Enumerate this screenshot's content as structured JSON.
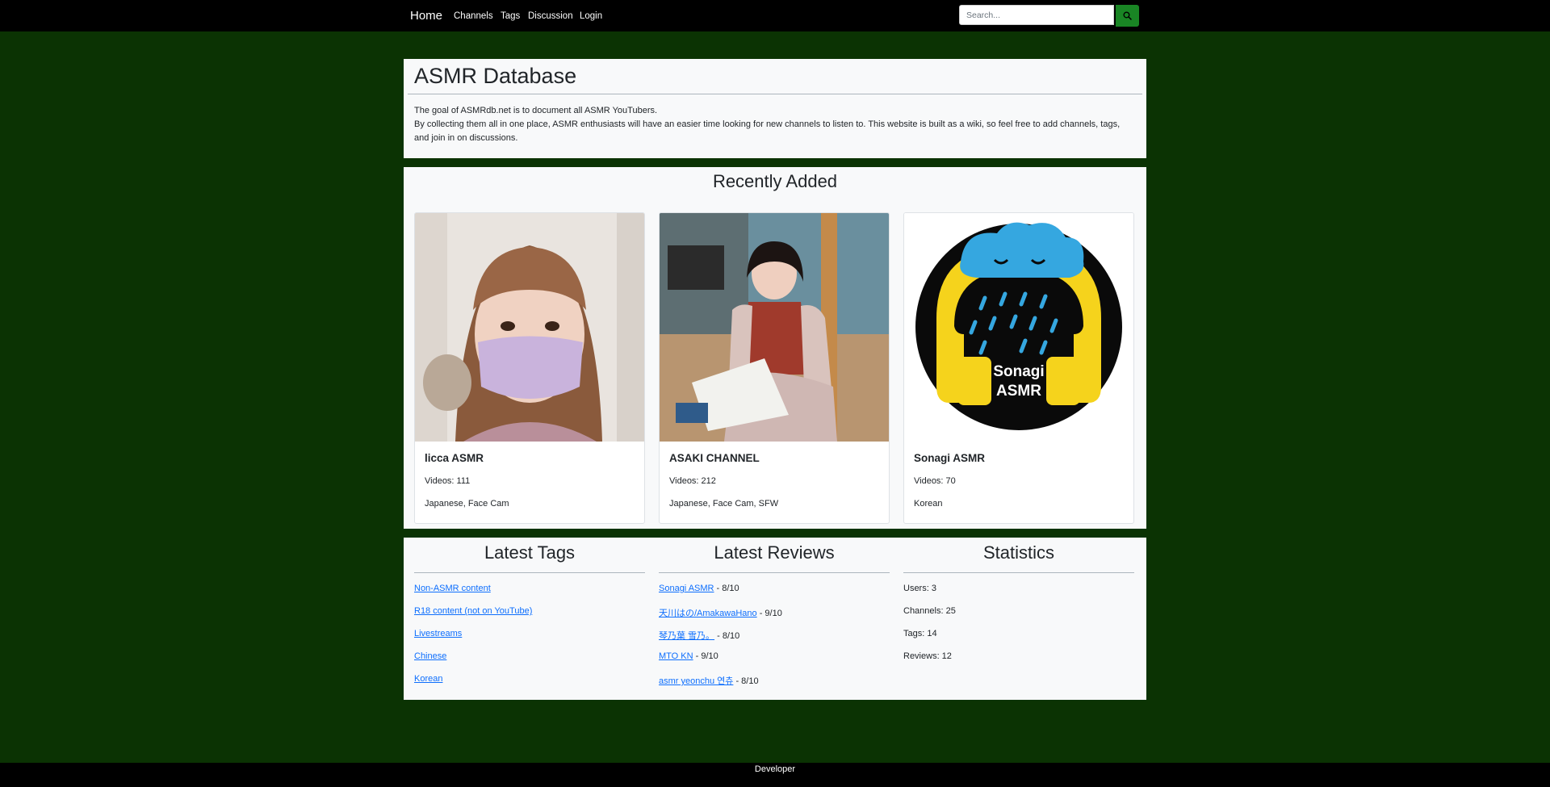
{
  "nav": {
    "brand": "Home",
    "links": [
      "Channels",
      "Tags",
      "Discussion",
      "Login"
    ],
    "search_placeholder": "Search...",
    "search_icon": "search-icon"
  },
  "header": {
    "title": "ASMR Database",
    "intro_line1": "The goal of ASMRdb.net is to document all ASMR YouTubers.",
    "intro_line2": "By collecting them all in one place, ASMR enthusiasts will have an easier time looking for new channels to listen to. This website is built as a wiki, so feel free to add channels, tags, and join in on discussions."
  },
  "recent": {
    "title": "Recently Added",
    "cards": [
      {
        "name": "licca ASMR",
        "videos": "Videos: 111",
        "tags": "Japanese, Face Cam"
      },
      {
        "name": "ASAKI CHANNEL",
        "videos": "Videos: 212",
        "tags": "Japanese, Face Cam, SFW"
      },
      {
        "name": "Sonagi ASMR",
        "videos": "Videos: 70",
        "tags": "Korean",
        "logo_text_1": "Sonagi",
        "logo_text_2": "ASMR"
      }
    ]
  },
  "latest_tags": {
    "title": "Latest Tags",
    "items": [
      "Non-ASMR content",
      "R18 content (not on YouTube)",
      "Livestreams",
      "Chinese",
      "Korean"
    ]
  },
  "latest_reviews": {
    "title": "Latest Reviews",
    "items": [
      {
        "name": "Sonagi ASMR",
        "score": " - 8/10"
      },
      {
        "name": "天川はの/AmakawaHano",
        "score": " - 9/10"
      },
      {
        "name": "琴乃葉 雪乃。",
        "score": " - 8/10"
      },
      {
        "name": "MTO KN",
        "score": " - 9/10"
      },
      {
        "name": "asmr yeonchu 연츄",
        "score": " - 8/10"
      }
    ]
  },
  "statistics": {
    "title": "Statistics",
    "items": [
      "Users: 3",
      "Channels: 25",
      "Tags: 14",
      "Reviews: 12"
    ]
  },
  "footer": {
    "label": "Developer"
  },
  "colors": {
    "background": "#0b3303",
    "navbar": "#000000",
    "panel": "#f8f9fa",
    "link": "#0d6efd",
    "search_button": "#198524"
  }
}
